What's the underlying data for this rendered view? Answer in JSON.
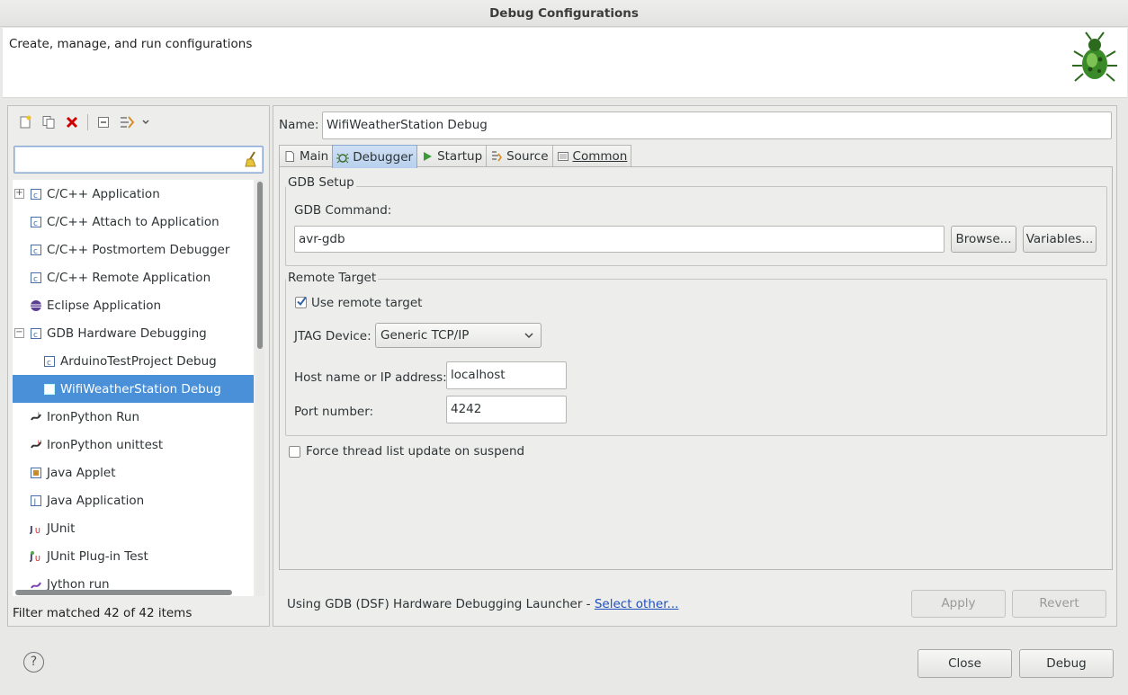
{
  "window": {
    "title": "Debug Configurations"
  },
  "banner": {
    "description": "Create, manage, and run configurations",
    "icon": "bug-icon"
  },
  "left_toolbar": {
    "items": [
      "new-config-icon",
      "duplicate-icon",
      "delete-icon",
      "collapse-all-icon",
      "filter-icon",
      "dropdown-icon"
    ]
  },
  "filter": {
    "value": "",
    "placeholder": ""
  },
  "tree": {
    "items": [
      {
        "label": "C/C++ Application",
        "icon": "c-app-icon",
        "expander": "+"
      },
      {
        "label": "C/C++ Attach to Application",
        "icon": "c-app-icon"
      },
      {
        "label": "C/C++ Postmortem Debugger",
        "icon": "c-app-icon"
      },
      {
        "label": "C/C++ Remote Application",
        "icon": "c-app-icon"
      },
      {
        "label": "Eclipse Application",
        "icon": "eclipse-icon"
      },
      {
        "label": "GDB Hardware Debugging",
        "icon": "c-app-icon",
        "expander": "−"
      },
      {
        "label": "ArduinoTestProject Debug",
        "icon": "c-app-icon"
      },
      {
        "label": "WifiWeatherStation Debug",
        "icon": "c-app-icon",
        "selected": true
      },
      {
        "label": "IronPython Run",
        "icon": "python-icon"
      },
      {
        "label": "IronPython unittest",
        "icon": "python-test-icon"
      },
      {
        "label": "Java Applet",
        "icon": "applet-icon"
      },
      {
        "label": "Java Application",
        "icon": "java-app-icon"
      },
      {
        "label": "JUnit",
        "icon": "junit-icon"
      },
      {
        "label": "JUnit Plug-in Test",
        "icon": "junit-plugin-icon"
      },
      {
        "label": "Jython run",
        "icon": "jython-icon"
      }
    ]
  },
  "filter_status": "Filter matched 42 of 42 items",
  "config": {
    "name_label": "Name:",
    "name_value": "WifiWeatherStation Debug",
    "tabs": [
      {
        "label": "Main",
        "icon": "main-tab-icon"
      },
      {
        "label": "Debugger",
        "icon": "debugger-tab-icon",
        "active": true
      },
      {
        "label": "Startup",
        "icon": "startup-tab-icon"
      },
      {
        "label": "Source",
        "icon": "source-tab-icon"
      },
      {
        "label": "Common",
        "icon": "common-tab-icon"
      }
    ],
    "gdb_setup": {
      "legend": "GDB Setup",
      "command_label": "GDB Command:",
      "command_value": "avr-gdb",
      "browse_label": "Browse...",
      "variables_label": "Variables..."
    },
    "remote_target": {
      "legend": "Remote Target",
      "use_remote_label": "Use remote target",
      "use_remote_checked": true,
      "jtag_label": "JTAG Device:",
      "jtag_value": "Generic TCP/IP",
      "host_label": "Host name or IP address:",
      "host_value": "localhost",
      "port_label": "Port number:",
      "port_value": "4242"
    },
    "force_thread_label": "Force thread list update on suspend",
    "force_thread_checked": false,
    "launcher_text": "Using GDB (DSF) Hardware Debugging Launcher - ",
    "launcher_link": "Select other...",
    "apply_label": "Apply",
    "revert_label": "Revert"
  },
  "footer": {
    "help": "?",
    "close_label": "Close",
    "debug_label": "Debug"
  },
  "colors": {
    "selection": "#4a90d9",
    "link": "#1f4fbf",
    "delete": "#cc0000"
  }
}
